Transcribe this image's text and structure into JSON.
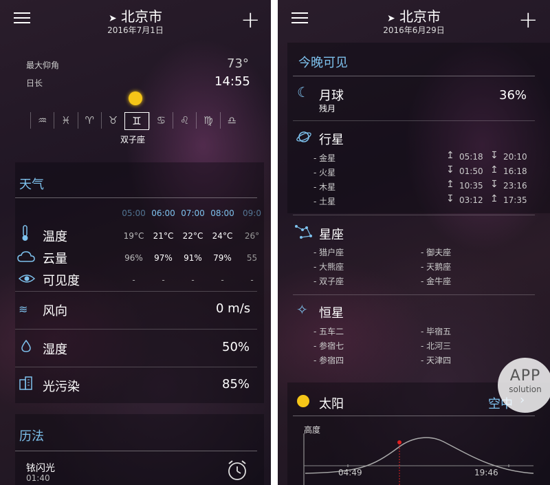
{
  "left": {
    "header": {
      "title": "北京市",
      "date": "2016年7月1日"
    },
    "sky": {
      "max_elevation_label": "最大仰角",
      "max_elevation_value": "73°",
      "day_length_label": "日长",
      "day_length_value": "14:55",
      "zodiac_symbols": [
        "♒",
        "♓",
        "♈",
        "♉",
        "♊",
        "♋",
        "♌",
        "♍",
        "♎"
      ],
      "active_sign": "双子座"
    },
    "weather": {
      "title": "天气",
      "hours": [
        "05:00",
        "06:00",
        "07:00",
        "08:00",
        "09:0"
      ],
      "temperature": {
        "label": "温度",
        "values": [
          "19°C",
          "21°C",
          "22°C",
          "24°C",
          "26°"
        ]
      },
      "cloud": {
        "label": "云量",
        "values": [
          "96%",
          "97%",
          "91%",
          "79%",
          "55"
        ]
      },
      "visibility": {
        "label": "可见度",
        "values": [
          "-",
          "-",
          "-",
          "-",
          "-"
        ]
      },
      "wind": {
        "label": "风向",
        "value": "0 m/s"
      },
      "humidity": {
        "label": "湿度",
        "value": "50%"
      },
      "light_pollution": {
        "label": "光污染",
        "value": "85%"
      }
    },
    "calendar": {
      "title": "历法",
      "event": "铱闪光",
      "time": "01:40"
    }
  },
  "right": {
    "header": {
      "title": "北京市",
      "date": "2016年6月29日"
    },
    "tonight": {
      "title": "今晚可见"
    },
    "moon": {
      "label": "月球",
      "phase": "残月",
      "value": "36%"
    },
    "planets": {
      "label": "行星",
      "items": [
        {
          "name": "- 金星",
          "rise": "05:18",
          "set": "20:10",
          "arrow": "↥"
        },
        {
          "name": "- 火星",
          "rise": "01:50",
          "set": "16:18",
          "arrow": "↧"
        },
        {
          "name": "- 木星",
          "rise": "10:35",
          "set": "23:16",
          "arrow": "↥"
        },
        {
          "name": "- 土星",
          "rise": "03:12",
          "set": "17:35",
          "arrow": "↧"
        }
      ]
    },
    "constellations": {
      "label": "星座",
      "left": [
        "- 猎户座",
        "- 大熊座",
        "- 双子座"
      ],
      "right": [
        "- 御夫座",
        "- 天鹅座",
        "- 金牛座"
      ]
    },
    "stars": {
      "label": "恒星",
      "left": [
        "- 五车二",
        "- 参宿七",
        "- 参宿四"
      ],
      "right": [
        "- 毕宿五",
        "- 北河三",
        "- 天津四"
      ]
    },
    "sun": {
      "label": "太阳",
      "status": "空中",
      "height_label": "高度",
      "rise": "04:49",
      "set": "19:46"
    }
  },
  "watermark": {
    "line1": "APP",
    "line2": "solution"
  },
  "colors": {
    "accent": "#7ec2ee",
    "sun": "#f5c518",
    "marker": "#e02020"
  }
}
